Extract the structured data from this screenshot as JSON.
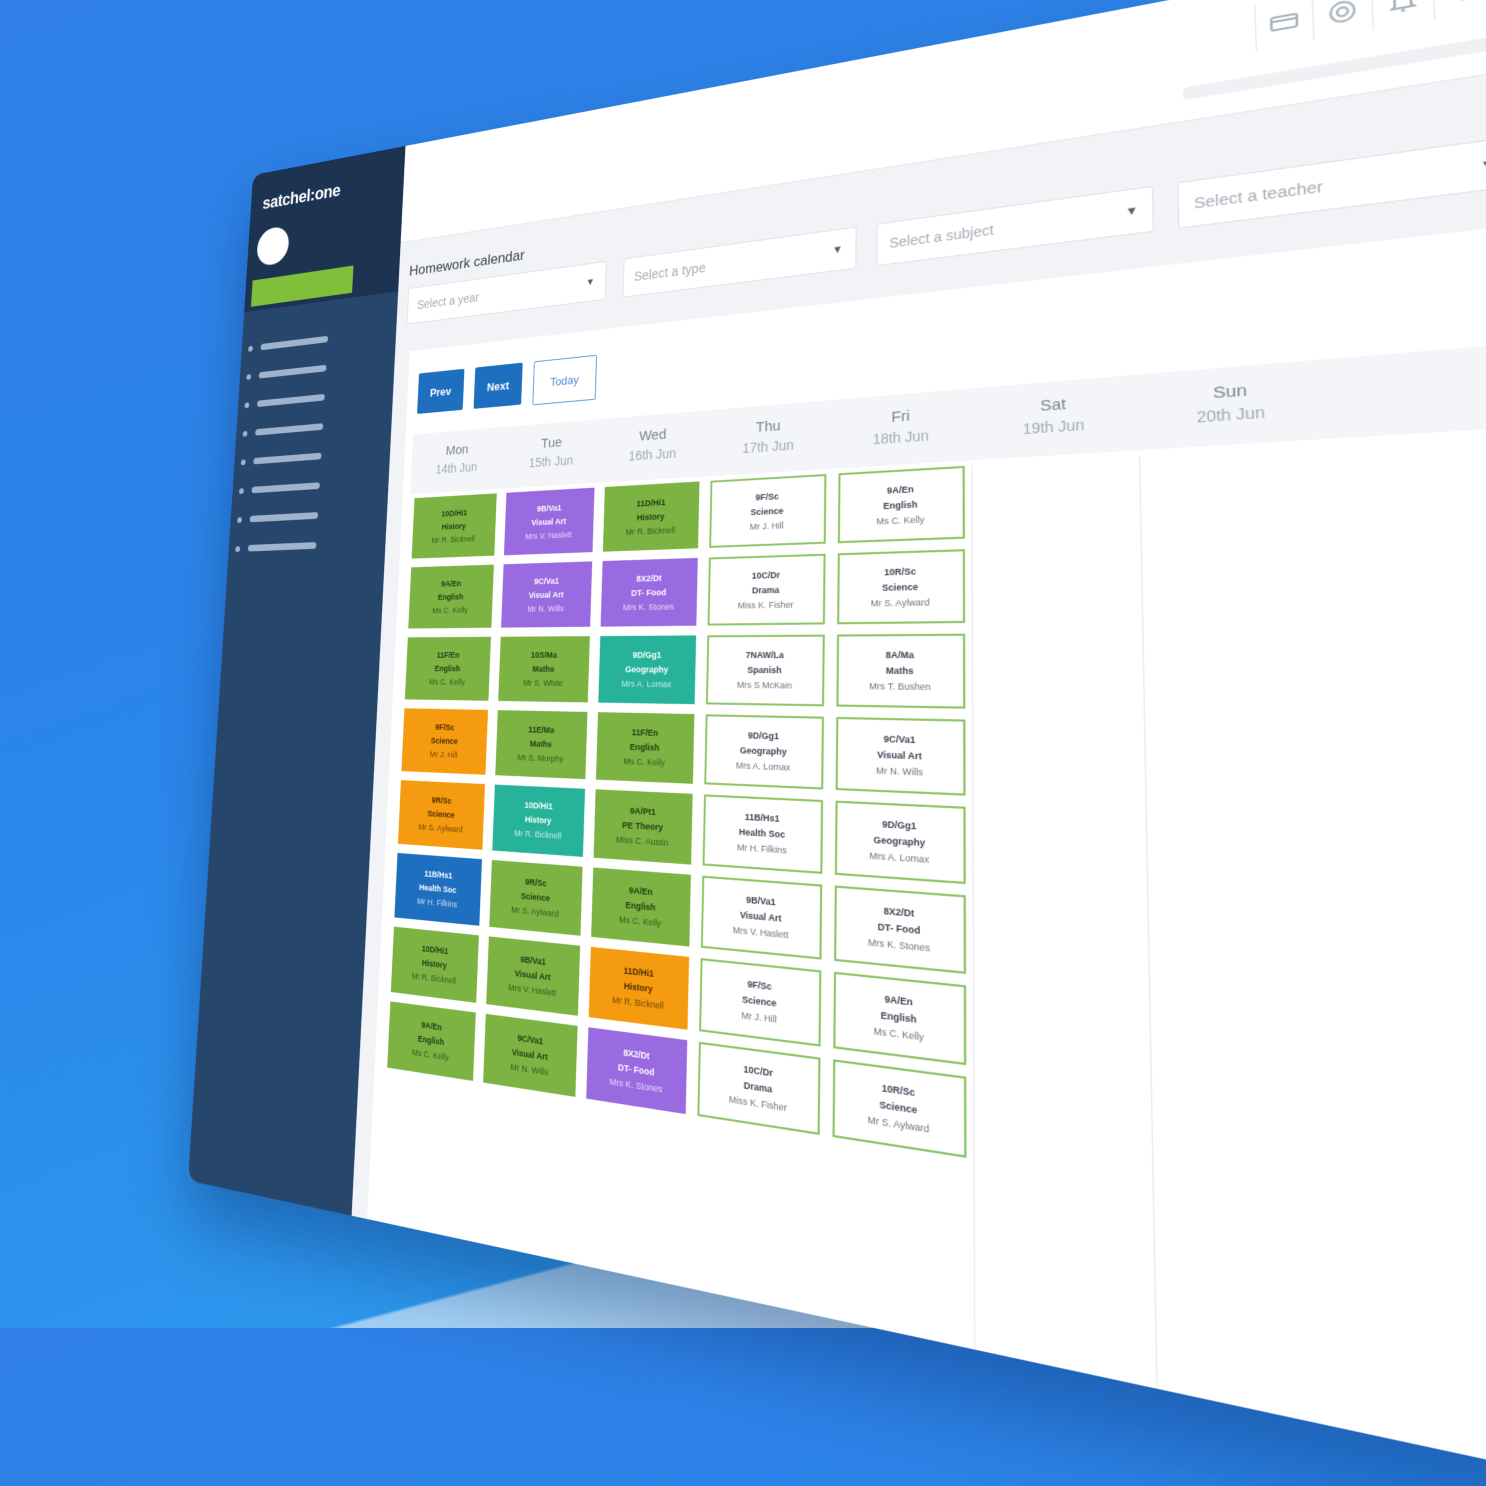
{
  "app": {
    "logo": "satchel:one"
  },
  "page": {
    "title": "Homework calendar"
  },
  "filters": [
    {
      "placeholder": "Select a year"
    },
    {
      "placeholder": "Select a type"
    },
    {
      "placeholder": "Select a subject"
    },
    {
      "placeholder": "Select a teacher"
    }
  ],
  "toolbar": {
    "prev": "Prev",
    "next": "Next",
    "today": "Today"
  },
  "days": [
    {
      "name": "Mon",
      "date": "14th Jun"
    },
    {
      "name": "Tue",
      "date": "15th Jun"
    },
    {
      "name": "Wed",
      "date": "16th Jun"
    },
    {
      "name": "Thu",
      "date": "17th Jun"
    },
    {
      "name": "Fri",
      "date": "18th Jun"
    },
    {
      "name": "Sat",
      "date": "19th Jun"
    },
    {
      "name": "Sun",
      "date": "20th Jun"
    }
  ],
  "colors": {
    "green": "#7cb342",
    "purple": "#9a6ae0",
    "teal": "#26b39a",
    "orange": "#f59b0f",
    "blue": "#1e6fc0",
    "sidebar": "#27466c"
  },
  "calendar": {
    "mon": [
      {
        "group": "10D/Hi1",
        "subject": "History",
        "teacher": "Mr R. Bicknell"
      },
      {
        "group": "9A/En",
        "subject": "English",
        "teacher": "Ms C. Kelly"
      },
      {
        "group": "11F/En",
        "subject": "English",
        "teacher": "Ms C. Kelly"
      },
      {
        "group": "9F/Sc",
        "subject": "Science",
        "teacher": "Mr J. Hill"
      },
      {
        "group": "9R/Sc",
        "subject": "Science",
        "teacher": "Mr S. Aylward"
      },
      {
        "group": "11B/Hs1",
        "subject": "Health Soc",
        "teacher": "Mr H. Filkins"
      },
      {
        "group": "10D/Hi1",
        "subject": "History",
        "teacher": "Mr R. Bicknell"
      },
      {
        "group": "9A/En",
        "subject": "English",
        "teacher": "Ms C. Kelly"
      }
    ],
    "tue": [
      {
        "group": "9B/Va1",
        "subject": "Visual Art",
        "teacher": "Mrs V. Haslett"
      },
      {
        "group": "9C/Va1",
        "subject": "Visual Art",
        "teacher": "Mr N. Wills"
      },
      {
        "group": "10S/Ma",
        "subject": "Maths",
        "teacher": "Mr S. White"
      },
      {
        "group": "11E/Ma",
        "subject": "Maths",
        "teacher": "Mr S. Murphy"
      },
      {
        "group": "10D/Hi1",
        "subject": "History",
        "teacher": "Mr R. Bicknell"
      },
      {
        "group": "9R/Sc",
        "subject": "Science",
        "teacher": "Mr S. Aylward"
      },
      {
        "group": "9B/Va1",
        "subject": "Visual Art",
        "teacher": "Mrs V. Haslett"
      },
      {
        "group": "9C/Va1",
        "subject": "Visual Art",
        "teacher": "Mr N. Wills"
      }
    ],
    "wed": [
      {
        "group": "11D/Hi1",
        "subject": "History",
        "teacher": "Mr R. Bicknell"
      },
      {
        "group": "8X2/Dt",
        "subject": "DT- Food",
        "teacher": "Mrs K. Stones"
      },
      {
        "group": "9D/Gg1",
        "subject": "Geography",
        "teacher": "Mrs A. Lomax"
      },
      {
        "group": "11F/En",
        "subject": "English",
        "teacher": "Ms C. Kelly"
      },
      {
        "group": "9A/Pt1",
        "subject": "PE Theory",
        "teacher": "Miss C. Austin"
      },
      {
        "group": "9A/En",
        "subject": "English",
        "teacher": "Ms C. Kelly"
      },
      {
        "group": "11D/Hi1",
        "subject": "History",
        "teacher": "Mr R. Bicknell"
      },
      {
        "group": "8X2/Dt",
        "subject": "DT- Food",
        "teacher": "Mrs K. Stones"
      }
    ],
    "thu": [
      {
        "group": "9F/Sc",
        "subject": "Science",
        "teacher": "Mr J. Hill"
      },
      {
        "group": "10C/Dr",
        "subject": "Drama",
        "teacher": "Miss K. Fisher"
      },
      {
        "group": "7NAW/La",
        "subject": "Spanish",
        "teacher": "Mrs S McKain"
      },
      {
        "group": "9D/Gg1",
        "subject": "Geography",
        "teacher": "Mrs A. Lomax"
      },
      {
        "group": "11B/Hs1",
        "subject": "Health Soc",
        "teacher": "Mr H. Filkins"
      },
      {
        "group": "9B/Va1",
        "subject": "Visual Art",
        "teacher": "Mrs V. Haslett"
      },
      {
        "group": "9F/Sc",
        "subject": "Science",
        "teacher": "Mr J. Hill"
      },
      {
        "group": "10C/Dr",
        "subject": "Drama",
        "teacher": "Miss K. Fisher"
      }
    ],
    "fri": [
      {
        "group": "9A/En",
        "subject": "English",
        "teacher": "Ms C. Kelly"
      },
      {
        "group": "10R/Sc",
        "subject": "Science",
        "teacher": "Mr S. Aylward"
      },
      {
        "group": "8A/Ma",
        "subject": "Maths",
        "teacher": "Mrs T. Bushen"
      },
      {
        "group": "9C/Va1",
        "subject": "Visual Art",
        "teacher": "Mr N. Wills"
      },
      {
        "group": "9D/Gg1",
        "subject": "Geography",
        "teacher": "Mrs A. Lomax"
      },
      {
        "group": "8X2/Dt",
        "subject": "DT- Food",
        "teacher": "Mrs K. Stones"
      },
      {
        "group": "9A/En",
        "subject": "English",
        "teacher": "Ms C. Kelly"
      },
      {
        "group": "10R/Sc",
        "subject": "Science",
        "teacher": "Mr S. Aylward"
      }
    ]
  }
}
